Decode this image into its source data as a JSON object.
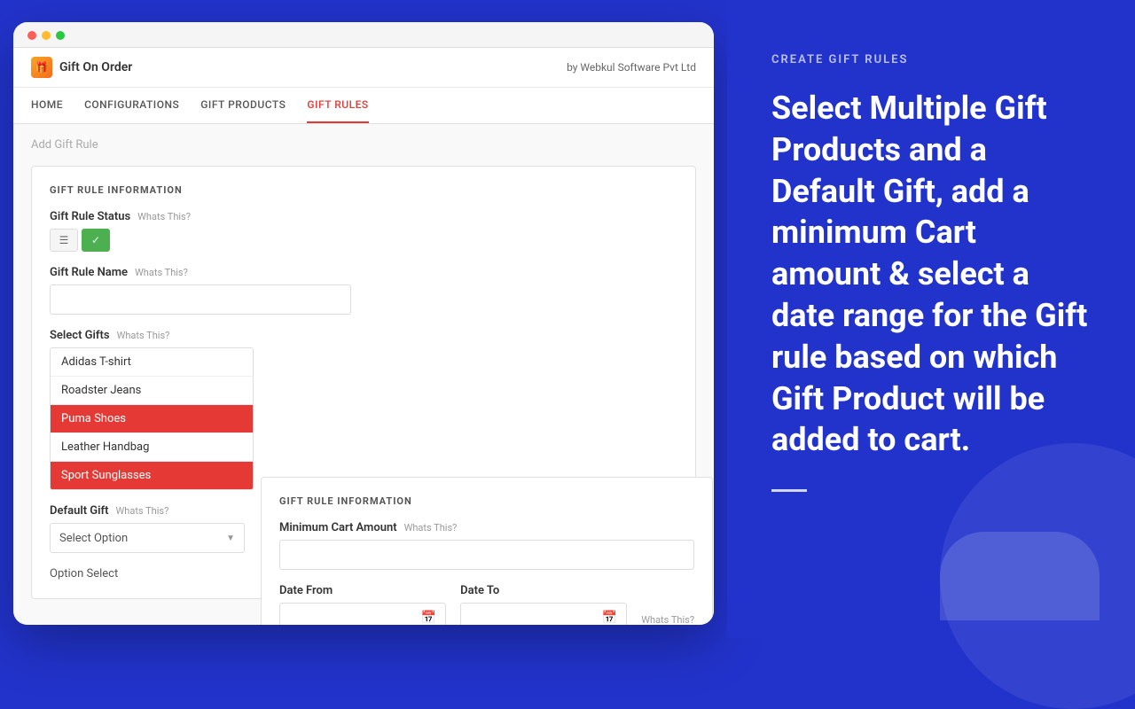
{
  "app": {
    "logo_icon": "🎁",
    "logo_name": "Gift On Order",
    "by_text": "by Webkul Software Pvt Ltd"
  },
  "nav": {
    "items": [
      {
        "label": "HOME",
        "active": false
      },
      {
        "label": "CONFIGURATIONS",
        "active": false
      },
      {
        "label": "GIFT PRODUCTS",
        "active": false
      },
      {
        "label": "GIFT RULES",
        "active": true
      }
    ]
  },
  "page": {
    "title": "Add Gift Rule"
  },
  "gift_rule_info": {
    "section_title": "GIFT RULE INFORMATION",
    "status_label": "Gift Rule Status",
    "status_whats_this": "Whats This?",
    "name_label": "Gift Rule Name",
    "name_whats_this": "Whats This?",
    "select_gifts_label": "Select Gifts",
    "select_gifts_whats_this": "Whats This?",
    "gift_items": [
      {
        "label": "Adidas T-shirt",
        "selected": false
      },
      {
        "label": "Roadster Jeans",
        "selected": false
      },
      {
        "label": "Puma Shoes",
        "selected": true
      },
      {
        "label": "Leather Handbag",
        "selected": false
      },
      {
        "label": "Sport Sunglasses",
        "selected": true
      }
    ],
    "default_gift_label": "Default Gift",
    "default_gift_whats_this": "Whats This?",
    "select_option_label": "Select Option",
    "option_select_label": "Option Select"
  },
  "gift_rule_info_2": {
    "section_title": "GIFT RULE INFORMATION",
    "min_cart_label": "Minimum Cart Amount",
    "min_cart_whats_this": "Whats This?",
    "date_from_label": "Date From",
    "date_to_label": "Date To",
    "date_whats_this": "Whats This?"
  },
  "right_panel": {
    "title": "CREATE GIFT RULES",
    "description": "Select Multiple Gift Products and a Default Gift, add a minimum Cart amount & select a date range for the Gift rule based on which Gift Product will be added to cart."
  }
}
